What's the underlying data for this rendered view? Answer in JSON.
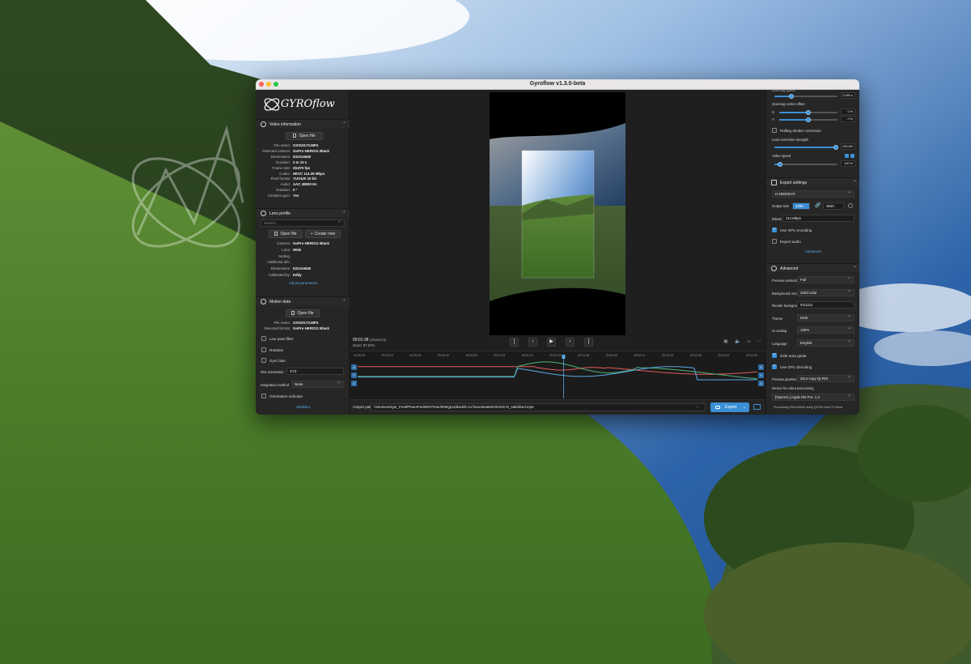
{
  "window": {
    "title": "Gyroflow v1.3.0-beta"
  },
  "app": {
    "logo_text": "GYROflow"
  },
  "video_info": {
    "title": "Video information",
    "open_file": "Open file",
    "fields": [
      {
        "key": "File name:",
        "value": "GX010173.MP4"
      },
      {
        "key": "Detected camera:",
        "value": "GoPro HERO11 Black"
      },
      {
        "key": "Dimensions:",
        "value": "5312x4648"
      },
      {
        "key": "Duration:",
        "value": "3 m 10 s"
      },
      {
        "key": "Frame rate:",
        "value": "29.970 fps"
      },
      {
        "key": "Codec:",
        "value": "HEVC 114.26 Mbps"
      },
      {
        "key": "Pixel format:",
        "value": "YUV420 10 bit"
      },
      {
        "key": "Audio:",
        "value": "AAC 48000 Hz"
      },
      {
        "key": "Rotation:",
        "value": "0 °"
      },
      {
        "key": "Contains gyro:",
        "value": "Yes"
      }
    ]
  },
  "lens_profile": {
    "title": "Lens profile",
    "search_placeholder": "Search...",
    "open_file": "Open file",
    "create_new": "Create new",
    "fields": [
      {
        "key": "Camera:",
        "value": "GoPro HERO11 Black"
      },
      {
        "key": "Lens:",
        "value": "Wide"
      },
      {
        "key": "Setting:",
        "value": ""
      },
      {
        "key": "Additional info:",
        "value": ""
      },
      {
        "key": "Dimensions:",
        "value": "5312x4648"
      },
      {
        "key": "Calibrated by:",
        "value": "Eddy"
      }
    ],
    "adjust_link": "Adjust parameters"
  },
  "motion_data": {
    "title": "Motion data",
    "open_file": "Open file",
    "fields": [
      {
        "key": "File name:",
        "value": "GX010173.MP4"
      },
      {
        "key": "Detected format:",
        "value": "GoPro HERO11 Black"
      }
    ],
    "low_pass": "Low pass filter",
    "rotation": "Rotation",
    "gyro_bias": "Gyro bias",
    "imu_label": "IMU orientation",
    "imu_value": "XYZ",
    "integration_label": "Integration method",
    "integration_value": "None",
    "orientation_indicator": "Orientation indicator",
    "statistics_link": "Statistics"
  },
  "player": {
    "time": "00:01:38",
    "frame": "(2954/5723)",
    "zoom": "Zoom: 97.67%",
    "btn_start": "[",
    "btn_prev": "‹",
    "btn_play": "▶",
    "btn_next": "›",
    "btn_end": "]",
    "speed": "1x"
  },
  "timeline": {
    "ticks": [
      "00:00:00",
      "00:00:13",
      "00:00:26",
      "00:00:39",
      "00:00:53",
      "00:01:06",
      "00:01:19",
      "00:01:32",
      "00:01:46",
      "00:01:59",
      "00:02:12",
      "00:02:25",
      "00:02:38",
      "00:02:52",
      "00:03:05"
    ],
    "axes": [
      "X",
      "Y",
      "Z"
    ],
    "playhead_fraction": 0.515
  },
  "output": {
    "label": "Output path:",
    "path": "/Volumes/Sgor_Fred/PhotoFred2007/Vrac/929/gp11black/8 col foron/avata/GX010173_stabilized.mp4",
    "export": "Export"
  },
  "stabilization": {
    "zooming_speed_label": "Zooming speed",
    "zooming_speed_value": "4.000 s",
    "zoom_center_label": "Zooming center offset",
    "x_label": "X",
    "x_value": "0 %",
    "y_label": "Y",
    "y_value": "0 %",
    "rolling_shutter": "Rolling shutter correction",
    "lens_correction_label": "Lens correction strength",
    "lens_correction_value": "100.0%",
    "video_speed_label": "Video speed",
    "video_speed_value": "100 %"
  },
  "export_settings": {
    "title": "Export settings",
    "codec": "H.265/HEVC",
    "output_size_label": "Output size",
    "width": "4290",
    "height": "3640",
    "bitrate_label": "Bitrate",
    "bitrate_value": "114 Mbps",
    "gpu_encoding": "Use GPU encoding",
    "export_audio": "Export audio",
    "advanced_link": "Advanced"
  },
  "advanced": {
    "title": "Advanced",
    "rows": [
      {
        "label": "Preview resolution",
        "value": "Full"
      },
      {
        "label": "Background mode",
        "value": "Solid color"
      },
      {
        "label": "Render background",
        "value": "#111111"
      },
      {
        "label": "Theme",
        "value": "Dark"
      },
      {
        "label": "UI scaling",
        "value": "100%"
      },
      {
        "label": "Language",
        "value": "English"
      }
    ],
    "safe_area": "Safe area guide",
    "gpu_decoding": "Use GPU decoding",
    "pipeline_label": "Preview pipeline",
    "pipeline_value": "Zero-copy Qt RHI",
    "device_label": "Device for video processing",
    "device_value": "[OpenCL] Apple M4 Pro: 1.2",
    "status": "Processing 5312x4648 using Qt RHI took 73.34ms"
  },
  "colors": {
    "accent": "#3a8fd6",
    "panel": "#262626",
    "background": "#1f1f1f"
  }
}
